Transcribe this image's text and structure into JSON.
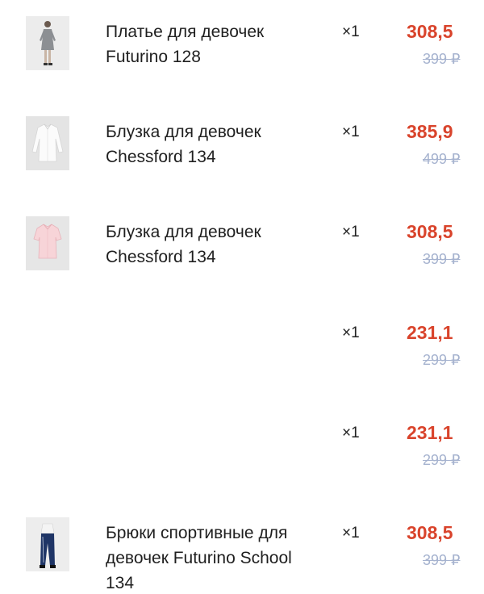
{
  "items": [
    {
      "title": "Платье для девочек Futurino 128",
      "qty": "×1",
      "price": "308,5",
      "old_price": "399 ₽",
      "image": "dress-photo"
    },
    {
      "title": "Блузка для девочек Chessford 134",
      "qty": "×1",
      "price": "385,9",
      "old_price": "499 ₽",
      "image": "white-blouse-photo"
    },
    {
      "title": "Блузка для девочек Chessford 134",
      "qty": "×1",
      "price": "308,5",
      "old_price": "399 ₽",
      "image": "pink-blouse-photo"
    },
    {
      "title": "",
      "qty": "×1",
      "price": "231,1",
      "old_price": "299 ₽",
      "image": ""
    },
    {
      "title": "",
      "qty": "×1",
      "price": "231,1",
      "old_price": "299 ₽",
      "image": ""
    },
    {
      "title": "Брюки спортивные для девочек Futurino School 134",
      "qty": "×1",
      "price": "308,5",
      "old_price": "399 ₽",
      "image": "sport-pants-photo"
    }
  ]
}
